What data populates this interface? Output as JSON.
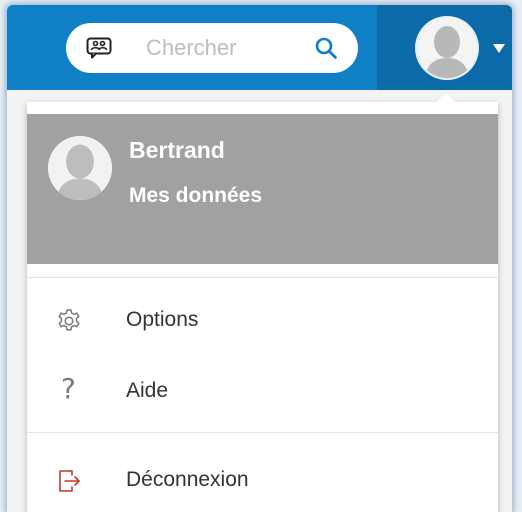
{
  "colors": {
    "topbar": "#0f7fc6",
    "topbar_right": "#0c6aa8",
    "profile_bg": "#a1a1a1",
    "logout_icon": "#c0392b"
  },
  "search": {
    "placeholder": "Chercher",
    "value": "",
    "left_icon": "contacts-icon",
    "right_icon": "search-icon"
  },
  "header": {
    "avatar_icon": "user-avatar",
    "dropdown_icon": "caret-down-icon"
  },
  "profile": {
    "name": "Bertrand",
    "link": "Mes données",
    "avatar_icon": "user-avatar"
  },
  "menu": {
    "options": {
      "label": "Options",
      "icon": "gear-icon"
    },
    "help": {
      "label": "Aide",
      "icon": "question-mark-icon",
      "glyph": "?"
    },
    "logout": {
      "label": "Déconnexion",
      "icon": "logout-icon"
    }
  }
}
